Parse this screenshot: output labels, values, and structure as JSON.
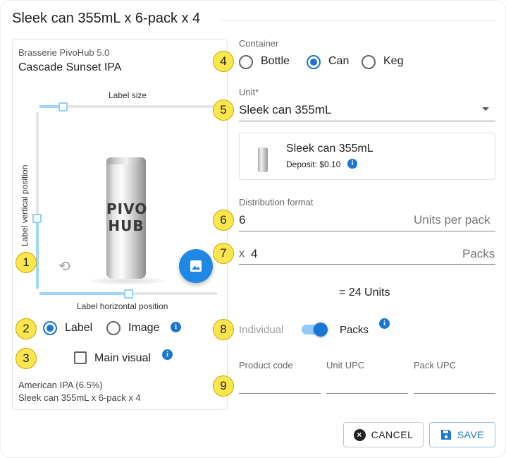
{
  "dialog": {
    "title": "Sleek can 355mL x 6-pack x 4"
  },
  "preview": {
    "brewery": "Brasserie PivoHub 5.0",
    "beer_name": "Cascade Sunset IPA",
    "label_size": "Label size",
    "label_vertical": "Label vertical position",
    "label_horizontal": "Label horizontal position",
    "can_text_line1": "PIVO",
    "can_text_line2": "HUB",
    "label_size_value": 0.13,
    "label_vertical_value": 0.37,
    "label_horizontal_value": 0.5
  },
  "visual_mode": {
    "options": [
      "Label",
      "Image"
    ],
    "selected": "Label",
    "main_visual": "Main visual",
    "main_visual_checked": false
  },
  "description": {
    "line1": "American IPA (6.5%)",
    "line2": "Sleek can 355mL x 6-pack x 4"
  },
  "container": {
    "label": "Container",
    "options": [
      "Bottle",
      "Can",
      "Keg"
    ],
    "selected": "Can"
  },
  "unit": {
    "label": "Unit*",
    "value": "Sleek can 355mL",
    "card_name": "Sleek can 355mL",
    "deposit": "Deposit: $0.10"
  },
  "distribution": {
    "label": "Distribution format",
    "units_per_pack": "6",
    "units_per_pack_suffix": "Units per pack",
    "packs_prefix": "x",
    "packs": "4",
    "packs_suffix": "Packs",
    "total": "= 24 Units"
  },
  "toggle": {
    "left": "Individual",
    "right": "Packs",
    "on": true
  },
  "codes": {
    "product_code": "Product code",
    "unit_upc": "Unit UPC",
    "pack_upc": "Pack UPC"
  },
  "badges": [
    "1",
    "2",
    "3",
    "4",
    "5",
    "6",
    "7",
    "8",
    "9"
  ],
  "actions": {
    "cancel": "CANCEL",
    "save": "SAVE"
  },
  "icons": {
    "info": "info-icon",
    "rotate": "rotate-icon",
    "image": "image-icon",
    "cancel": "close-circle-icon",
    "save": "floppy-disk-icon"
  },
  "colors": {
    "accent": "#1976d2",
    "badge": "#fde64d",
    "slider": "#9fd6f8"
  }
}
